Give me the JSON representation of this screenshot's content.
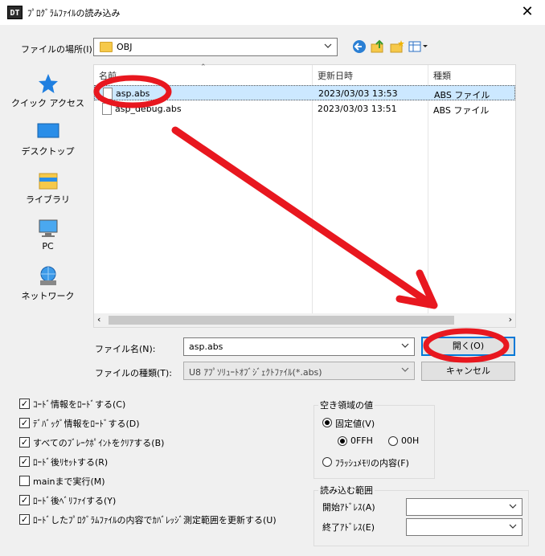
{
  "window": {
    "app_badge": "DT",
    "title": "ﾌﾟﾛｸﾞﾗﾑﾌｧｲﾙの読み込み"
  },
  "location": {
    "label": "ファイルの場所(I):",
    "value": "OBJ"
  },
  "places": [
    {
      "label": "クイック アクセス",
      "icon": "star-icon"
    },
    {
      "label": "デスクトップ",
      "icon": "desktop-icon"
    },
    {
      "label": "ライブラリ",
      "icon": "library-icon"
    },
    {
      "label": "PC",
      "icon": "pc-icon"
    },
    {
      "label": "ネットワーク",
      "icon": "network-icon"
    }
  ],
  "columns": {
    "name": "名前",
    "modified": "更新日時",
    "type": "種類"
  },
  "files": [
    {
      "name": "asp.abs",
      "modified": "2023/03/03 13:53",
      "type": "ABS ファイル",
      "selected": true
    },
    {
      "name": "asp_debug.abs",
      "modified": "2023/03/03 13:51",
      "type": "ABS ファイル",
      "selected": false
    }
  ],
  "filename": {
    "label": "ファイル名(N):",
    "value": "asp.abs"
  },
  "filetype": {
    "label": "ファイルの種類(T):",
    "value": "U8 ｱﾌﾟｿﾘｭｰﾄｵﾌﾞｼﾞｪｸﾄﾌｧｲﾙ(*.abs)"
  },
  "buttons": {
    "open": "開く(O)",
    "cancel": "キャンセル"
  },
  "checkboxes": [
    {
      "label": "ｺｰﾄﾞ情報をﾛｰﾄﾞする(C)",
      "checked": true
    },
    {
      "label": "ﾃﾞﾊﾞｯｸﾞ情報をﾛｰﾄﾞする(D)",
      "checked": true
    },
    {
      "label": "すべてのﾌﾞﾚｰｸﾎﾟｲﾝﾄをｸﾘｱする(B)",
      "checked": true
    },
    {
      "label": "ﾛｰﾄﾞ後ﾘｾｯﾄする(R)",
      "checked": true
    },
    {
      "label": "mainまで実行(M)",
      "checked": false
    },
    {
      "label": "ﾛｰﾄﾞ後ﾍﾞﾘﾌｧｲする(Y)",
      "checked": true
    },
    {
      "label": "ﾛｰﾄﾞしたﾌﾟﾛｸﾞﾗﾑﾌｧｲﾙの内容でｶﾊﾞﾚｯｼﾞ測定範囲を更新する(U)",
      "checked": true
    }
  ],
  "empty_area": {
    "title": "空き領域の値",
    "fixed_label": "固定値(V)",
    "fixed_selected": true,
    "hex_0ff": "0FFH",
    "hex_0ff_selected": true,
    "hex_00": "00H",
    "hex_00_selected": false,
    "flash_label": "ﾌﾗｯｼｭﾒﾓﾘの内容(F)",
    "flash_selected": false
  },
  "range": {
    "title": "読み込む範囲",
    "start_label": "開始ｱﾄﾞﾚｽ(A)",
    "start_value": "",
    "end_label": "終了ｱﾄﾞﾚｽ(E)",
    "end_value": ""
  },
  "colors": {
    "annotation": "#e8171f",
    "selection": "#cce8ff",
    "default_button_border": "#0078d7"
  }
}
